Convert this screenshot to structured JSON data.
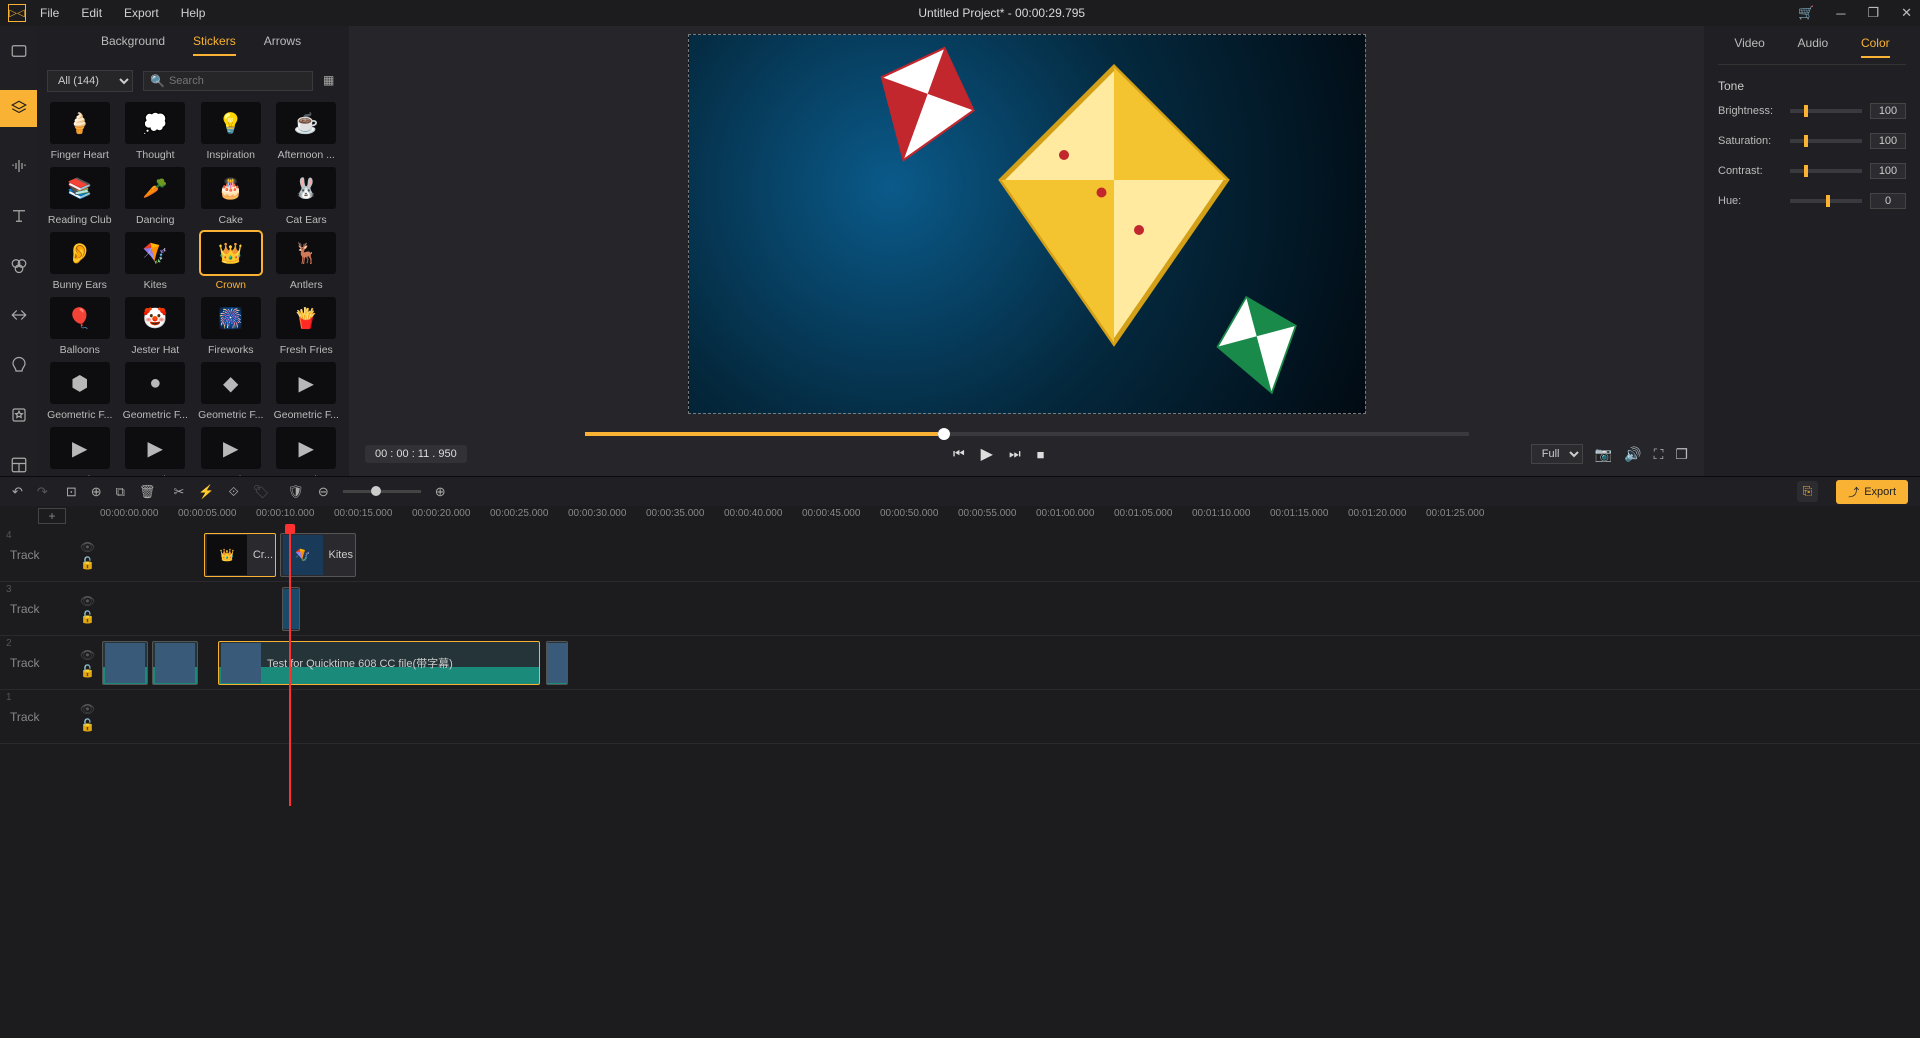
{
  "titlebar": {
    "menus": [
      "File",
      "Edit",
      "Export",
      "Help"
    ],
    "title": "Untitled Project* - 00:00:29.795"
  },
  "asset_tabs": {
    "background": "Background",
    "stickers": "Stickers",
    "arrows": "Arrows"
  },
  "filter": {
    "label": "All (144)",
    "search_placeholder": "Search"
  },
  "stickers": [
    {
      "label": "Finger Heart",
      "emoji": "🍦"
    },
    {
      "label": "Thought",
      "emoji": "💭"
    },
    {
      "label": "Inspiration",
      "emoji": "💡"
    },
    {
      "label": "Afternoon ...",
      "emoji": "☕"
    },
    {
      "label": "Reading Club",
      "emoji": "📚"
    },
    {
      "label": "Dancing",
      "emoji": "🥕"
    },
    {
      "label": "Cake",
      "emoji": "🎂"
    },
    {
      "label": "Cat Ears",
      "emoji": "🐰"
    },
    {
      "label": "Bunny Ears",
      "emoji": "👂"
    },
    {
      "label": "Kites",
      "emoji": "🪁"
    },
    {
      "label": "Crown",
      "emoji": "👑",
      "selected": true
    },
    {
      "label": "Antlers",
      "emoji": "🦌"
    },
    {
      "label": "Balloons",
      "emoji": "🎈"
    },
    {
      "label": "Jester Hat",
      "emoji": "🤡"
    },
    {
      "label": "Fireworks",
      "emoji": "🎆"
    },
    {
      "label": "Fresh Fries",
      "emoji": "🍟"
    },
    {
      "label": "Geometric F...",
      "emoji": "⬢"
    },
    {
      "label": "Geometric F...",
      "emoji": "●"
    },
    {
      "label": "Geometric F...",
      "emoji": "◆"
    },
    {
      "label": "Geometric F...",
      "emoji": "▶"
    },
    {
      "label": "Geometric F...",
      "emoji": "▶"
    },
    {
      "label": "Geometric F...",
      "emoji": "▶"
    },
    {
      "label": "Geometric F...",
      "emoji": "▶"
    },
    {
      "label": "Geometric F...",
      "emoji": "▶"
    }
  ],
  "preview": {
    "timecode": "00 : 00 : 11 . 950",
    "fitmode": "Full"
  },
  "right_tabs": {
    "video": "Video",
    "audio": "Audio",
    "color": "Color"
  },
  "tone": {
    "heading": "Tone",
    "rows": [
      {
        "label": "Brightness:",
        "value": "100",
        "pos": 20
      },
      {
        "label": "Saturation:",
        "value": "100",
        "pos": 20
      },
      {
        "label": "Contrast:",
        "value": "100",
        "pos": 20
      },
      {
        "label": "Hue:",
        "value": "0",
        "pos": 50
      }
    ]
  },
  "toolbar": {
    "export": "Export"
  },
  "ruler_marks": [
    "00:00:00.000",
    "00:00:05.000",
    "00:00:10.000",
    "00:00:15.000",
    "00:00:20.000",
    "00:00:25.000",
    "00:00:30.000",
    "00:00:35.000",
    "00:00:40.000",
    "00:00:45.000",
    "00:00:50.000",
    "00:00:55.000",
    "00:01:00.000",
    "00:01:05.000",
    "00:01:10.000",
    "00:01:15.000",
    "00:01:20.000",
    "00:01:25.000"
  ],
  "tracks": {
    "label": "Track",
    "idx": [
      "4",
      "3",
      "2",
      "1"
    ]
  },
  "clips": {
    "crown": "Cr...",
    "kites": "Kites",
    "vidname": "Test for Quicktime 608 CC file(带字幕)"
  }
}
